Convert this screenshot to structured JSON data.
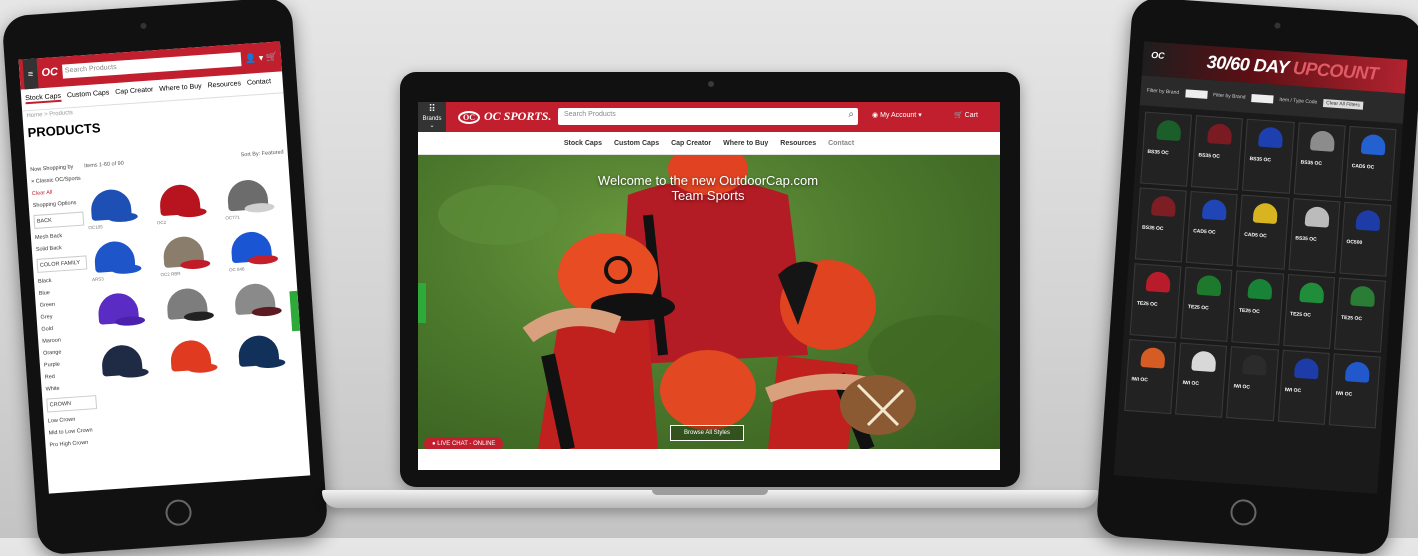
{
  "left_tablet": {
    "header": {
      "menu_icon": "hamburger-icon",
      "logo": "OC",
      "search_placeholder": "Search Products",
      "icons": "👤 ▾ 🛒"
    },
    "nav_tabs": [
      "Stock Caps",
      "Custom Caps",
      "Cap Creator",
      "Where to Buy",
      "Resources",
      "Contact"
    ],
    "breadcrumb": "Home > Products",
    "page_title": "PRODUCTS",
    "sort_label": "Now Shopping by",
    "items_count": "Items 1-60 of 90",
    "sort_by": "Sort By: Featured",
    "sidebar": {
      "filter_chip": "× Classic OC/Sports",
      "clear_all": "Clear All",
      "shopping_options": "Shopping Options",
      "groups": [
        {
          "title": "BACK",
          "items": [
            "Mesh Back",
            "Solid Back"
          ]
        },
        {
          "title": "COLOR FAMILY",
          "items": [
            "Black",
            "Blue",
            "Green",
            "Grey",
            "Gold",
            "Maroon",
            "Orange",
            "Purple",
            "Red",
            "White"
          ]
        },
        {
          "title": "CROWN",
          "items": [
            "Low Crown",
            "Mid to Low Crown",
            "Pro High Crown"
          ]
        }
      ]
    },
    "caps": [
      {
        "label": "OC105",
        "color": "#1d4fb5",
        "brim": "#1d4fb5"
      },
      {
        "label": "OC2",
        "color": "#b8141f",
        "brim": "#b8141f"
      },
      {
        "label": "OC771",
        "color": "#6c6c6c",
        "brim": "#cfcfcf"
      },
      {
        "label": "ARS3",
        "color": "#1e55c9",
        "brim": "#1e55c9"
      },
      {
        "label": "OC2 RBR",
        "color": "#8a7d6c",
        "brim": "#c01b26"
      },
      {
        "label": "OC 846",
        "color": "#1a56d3",
        "brim": "#c41f2a"
      },
      {
        "label": "",
        "color": "#5a2cc4",
        "brim": "#4b22ac"
      },
      {
        "label": "",
        "color": "#7d7d7d",
        "brim": "#222222"
      },
      {
        "label": "",
        "color": "#8a8a8a",
        "brim": "#5e1a22"
      },
      {
        "label": "",
        "color": "#1f2a44",
        "brim": "#1f2a44"
      },
      {
        "label": "",
        "color": "#e03a20",
        "brim": "#e03a20"
      },
      {
        "label": "",
        "color": "#12315a",
        "brim": "#12315a"
      }
    ]
  },
  "laptop": {
    "brands": {
      "icon": "grid-icon",
      "label": "Brands"
    },
    "logo": "OC SPORTS.",
    "search_placeholder": "Search Products",
    "search_icon": "search-icon",
    "account_label": "My Account",
    "cart_label": "Cart",
    "nav": [
      "Stock Caps",
      "Custom Caps",
      "Cap Creator",
      "Where to Buy",
      "Resources",
      "Contact"
    ],
    "hero": {
      "welcome_line1": "Welcome to the new OutdoorCap.com",
      "welcome_line2": "Team Sports",
      "browse_button": "Browse All Styles"
    },
    "live_chat": "LIVE CHAT - ONLINE"
  },
  "right_tablet": {
    "banner": {
      "logo": "OC",
      "title_a": "30/60 DAY ",
      "title_b": "UPCOUNT"
    },
    "filters": [
      "Filter by Brand",
      "Filter by Brand",
      "Item / Type Code"
    ],
    "filter_button": "Clear All Filters",
    "cards": [
      {
        "name": "BS35 OC",
        "color": "#1c5e2a"
      },
      {
        "name": "BS35 OC",
        "color": "#7a1a22"
      },
      {
        "name": "BS35 OC",
        "color": "#1e3fb0"
      },
      {
        "name": "BS35 OC",
        "color": "#8c8c8c"
      },
      {
        "name": "CAD5 OC",
        "color": "#2360d0"
      },
      {
        "name": "BS35 OC",
        "color": "#7d1d24"
      },
      {
        "name": "CAD5 OC",
        "color": "#1f45b6"
      },
      {
        "name": "CAD5 OC",
        "color": "#d8b420"
      },
      {
        "name": "BS35 OC",
        "color": "#bbbbbb"
      },
      {
        "name": "OC500",
        "color": "#1e3ca8"
      },
      {
        "name": "TE25 OC",
        "color": "#b81c2a"
      },
      {
        "name": "TE25 OC",
        "color": "#1d7a2c"
      },
      {
        "name": "TE25 OC",
        "color": "#188236"
      },
      {
        "name": "TE25 OC",
        "color": "#1f8d3a"
      },
      {
        "name": "TE25 OC",
        "color": "#2a7d34"
      },
      {
        "name": "IWI OC",
        "color": "#d55c22"
      },
      {
        "name": "IWI OC",
        "color": "#d8d8d8"
      },
      {
        "name": "IWI OC",
        "color": "#2b2b2b"
      },
      {
        "name": "IWI OC",
        "color": "#1d3ca8"
      },
      {
        "name": "IWI OC",
        "color": "#2158cc"
      }
    ]
  },
  "colors": {
    "brand_red": "#c11f2e",
    "chat_green": "#2eaa3a"
  }
}
